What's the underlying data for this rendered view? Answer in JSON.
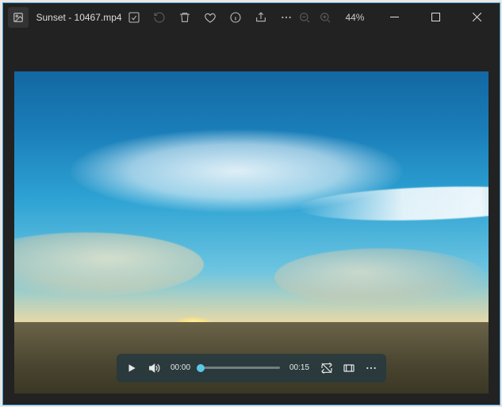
{
  "title": "Sunset - 10467.mp4",
  "zoom_pct": "44%",
  "player": {
    "current_time": "00:00",
    "duration": "00:15"
  },
  "icons": {
    "app": "image-icon",
    "edit": "edit-image-icon",
    "rotate": "rotate-icon",
    "delete": "trash-icon",
    "favorite": "heart-icon",
    "info": "info-icon",
    "share": "share-icon",
    "more": "more-icon",
    "zoom_out": "zoom-out-icon",
    "zoom_in": "zoom-in-icon",
    "minimize": "minimize-icon",
    "maximize": "maximize-icon",
    "close": "close-icon",
    "play": "play-icon",
    "volume": "volume-icon",
    "loop": "loop-off-icon",
    "subtract_time": "trim-icon",
    "player_more": "more-icon"
  }
}
